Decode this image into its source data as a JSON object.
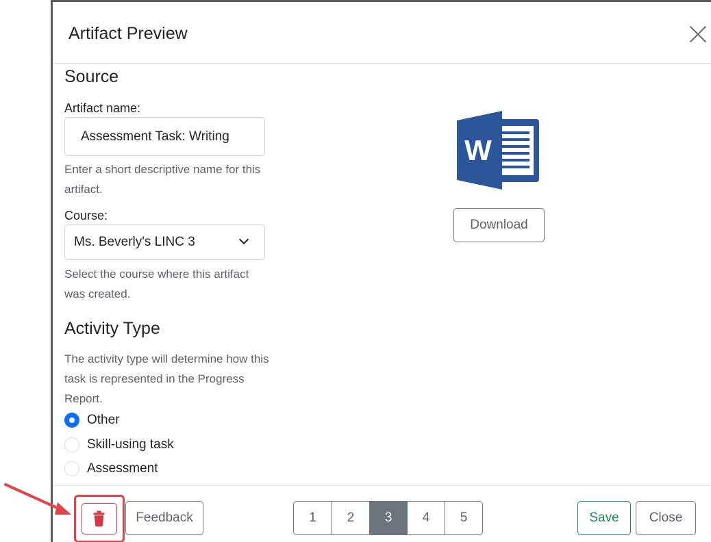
{
  "modal": {
    "title": "Artifact Preview"
  },
  "source": {
    "heading": "Source",
    "artifact_name_label": "Artifact name:",
    "artifact_name_value": "Assessment Task: Writing",
    "artifact_name_help": "Enter a short descriptive name for this artifact.",
    "course_label": "Course:",
    "course_value": "Ms. Beverly's LINC 3",
    "course_help": "Select the course where this artifact was created."
  },
  "activity": {
    "heading": "Activity Type",
    "help": "The activity type will determine how this task is represented in the Progress Report.",
    "options": [
      {
        "label": "Other",
        "checked": true
      },
      {
        "label": "Skill-using task",
        "checked": false
      },
      {
        "label": "Assessment",
        "checked": false
      }
    ]
  },
  "preview": {
    "file_icon": "microsoft-word-icon",
    "download_label": "Download"
  },
  "footer": {
    "delete_icon": "trash-icon",
    "feedback_label": "Feedback",
    "pages": [
      "1",
      "2",
      "3",
      "4",
      "5"
    ],
    "active_page": "3",
    "save_label": "Save",
    "close_label": "Close"
  },
  "colors": {
    "primary": "#0d6efd",
    "danger": "#dc3545",
    "success": "#198754",
    "secondary": "#6c757d",
    "word_blue": "#2b579a",
    "annotation_red": "#e5434a"
  }
}
